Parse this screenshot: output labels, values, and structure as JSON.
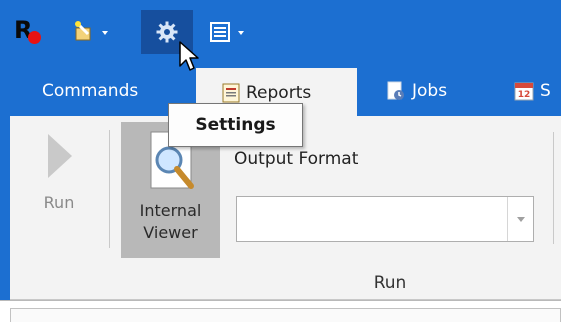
{
  "quick_access": {
    "logo_letter": "R",
    "buttons": [
      {
        "icon": "wand-icon",
        "has_dropdown": true
      },
      {
        "icon": "gear-icon",
        "has_dropdown": false,
        "hover": true
      },
      {
        "icon": "layout-icon",
        "has_dropdown": true
      }
    ]
  },
  "tabs": [
    {
      "label": "Commands",
      "active": false
    },
    {
      "label": "Reports",
      "active": true
    },
    {
      "label": "Jobs",
      "active": false
    },
    {
      "label": "S",
      "active": false
    }
  ],
  "ribbon": {
    "run_label": "Run",
    "viewer_label_line1": "Internal",
    "viewer_label_line2": "Viewer",
    "output_format_label": "Output Format",
    "output_format_value": "",
    "group_label": "Run"
  },
  "tooltip": {
    "text": "Settings"
  },
  "colors": {
    "title_bar": "#1c6fd1",
    "hover_button": "#164f9e",
    "ribbon_bg": "#f3f3f3",
    "viewer_selected": "#b8b8b8"
  }
}
